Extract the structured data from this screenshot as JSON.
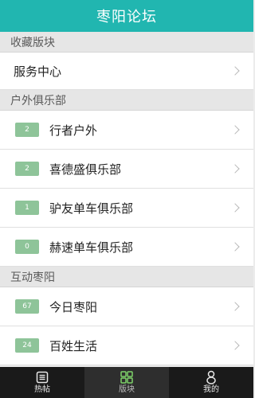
{
  "header": {
    "title": "枣阳论坛"
  },
  "sections": [
    {
      "title": "收藏版块",
      "items": [
        {
          "label": "服务中心"
        }
      ]
    },
    {
      "title": "户外俱乐部",
      "items": [
        {
          "badge": "2",
          "label": "行者户外"
        },
        {
          "badge": "2",
          "label": "喜德盛俱乐部"
        },
        {
          "badge": "1",
          "label": "驴友单车俱乐部"
        },
        {
          "badge": "0",
          "label": "赫速单车俱乐部"
        }
      ]
    },
    {
      "title": "互动枣阳",
      "items": [
        {
          "badge": "67",
          "label": "今日枣阳"
        },
        {
          "badge": "24",
          "label": "百姓生活"
        }
      ]
    }
  ],
  "tabbar": {
    "tabs": [
      {
        "label": "热帖",
        "icon": "hot-posts-icon"
      },
      {
        "label": "版块",
        "icon": "boards-grid-icon"
      },
      {
        "label": "我的",
        "icon": "profile-icon"
      }
    ],
    "active_index": 1
  },
  "colors": {
    "header_bg": "#21b6b0",
    "badge_bg": "#8ec499",
    "tabbar_bg": "#1a1a1a",
    "active_icon": "#7fd36a"
  }
}
